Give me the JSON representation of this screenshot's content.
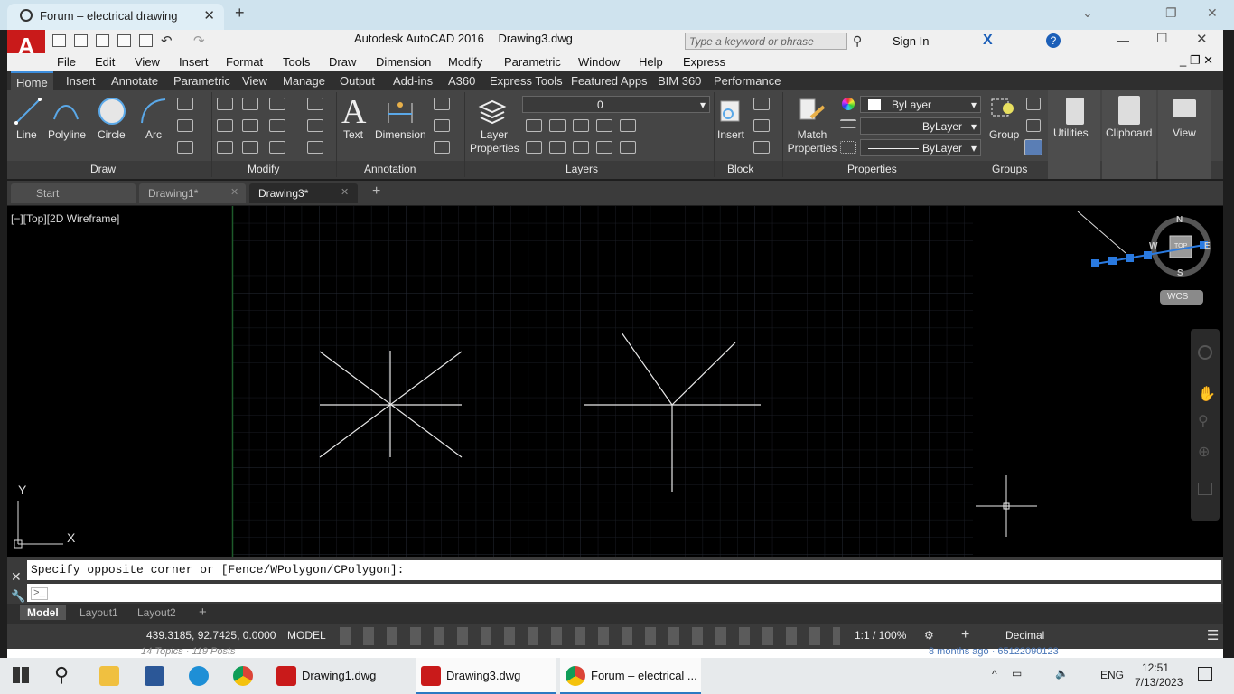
{
  "browser": {
    "tab_title": "Forum – electrical drawing",
    "new_tab": "+"
  },
  "app": {
    "logo": "A",
    "product": "Autodesk AutoCAD 2016",
    "file": "Drawing3.dwg"
  },
  "search": {
    "placeholder": "Type a keyword or phrase"
  },
  "account": {
    "sign_in": "Sign In"
  },
  "menu": [
    "File",
    "Edit",
    "View",
    "Insert",
    "Format",
    "Tools",
    "Draw",
    "Dimension",
    "Modify",
    "Parametric",
    "Window",
    "Help",
    "Express"
  ],
  "ribbon_tabs": [
    "Home",
    "Insert",
    "Annotate",
    "Parametric",
    "View",
    "Manage",
    "Output",
    "Add-ins",
    "A360",
    "Express Tools",
    "Featured Apps",
    "BIM 360",
    "Performance"
  ],
  "ribbon": {
    "draw": {
      "line": "Line",
      "polyline": "Polyline",
      "circle": "Circle",
      "arc": "Arc",
      "panel": "Draw"
    },
    "modify": {
      "panel": "Modify"
    },
    "annotation": {
      "text": "Text",
      "dimension": "Dimension",
      "panel": "Annotation"
    },
    "layers": {
      "layer_properties": "Layer Properties",
      "current_layer": "0",
      "panel": "Layers"
    },
    "block": {
      "insert": "Insert",
      "panel": "Block"
    },
    "properties": {
      "match": "Match Properties",
      "color": "ByLayer",
      "linetype": "ByLayer",
      "lineweight": "ByLayer",
      "panel": "Properties"
    },
    "groups": {
      "group": "Group",
      "panel": "Groups"
    },
    "utilities": "Utilities",
    "clipboard": "Clipboard",
    "view": "View"
  },
  "file_tabs": [
    "Start",
    "Drawing1*",
    "Drawing3*"
  ],
  "viewport": {
    "label": "[−][Top][2D Wireframe]",
    "axis_y": "Y",
    "axis_x": "X"
  },
  "viewcube": {
    "n": "N",
    "s": "S",
    "w": "W",
    "e": "E",
    "top": "TOP",
    "wcs": "WCS"
  },
  "command": {
    "prompt": "Specify opposite corner or [Fence/WPolygon/CPolygon]:",
    "input_prefix": ">_"
  },
  "layout_tabs": [
    "Model",
    "Layout1",
    "Layout2"
  ],
  "status": {
    "coords": "439.3185, 92.7425, 0.0000",
    "space": "MODEL",
    "scale": "1:1 / 100%",
    "units": "Decimal"
  },
  "behind": {
    "topics": "14 Topics · 119 Posts",
    "ago": "8 months ago · 65122090123"
  },
  "taskbar": {
    "item1": "Drawing1.dwg",
    "item2": "Drawing3.dwg",
    "item3": "Forum – electrical ...",
    "lang": "ENG",
    "time": "12:51",
    "date": "7/13/2023"
  }
}
